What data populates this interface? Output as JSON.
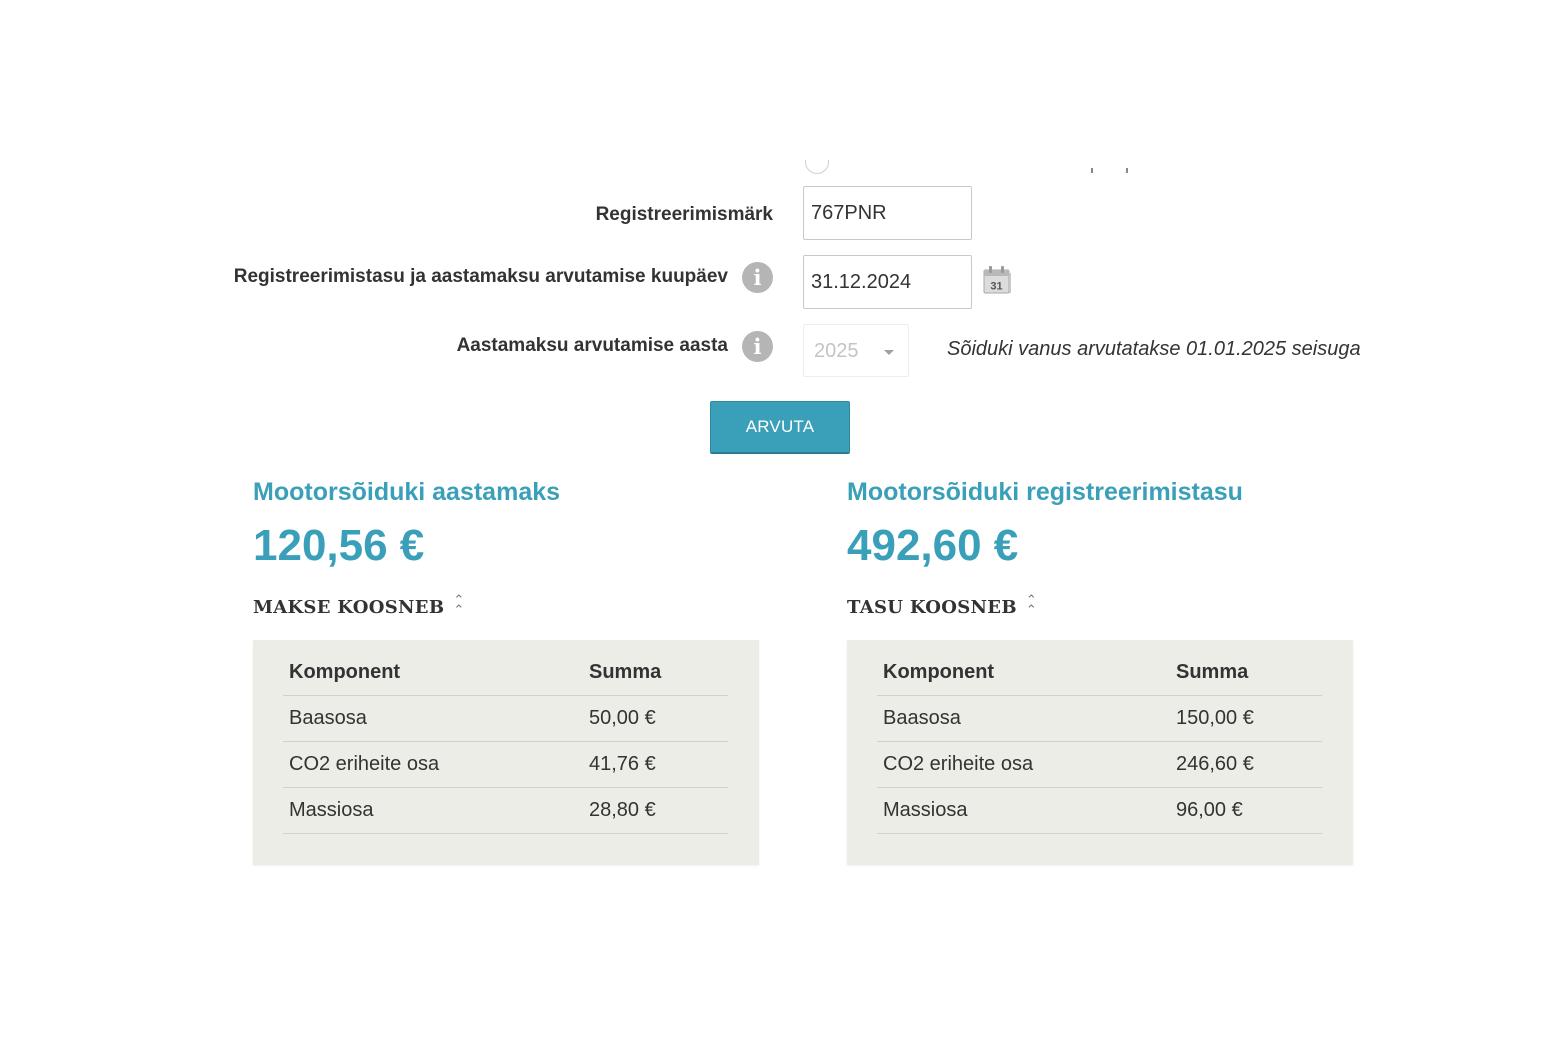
{
  "form": {
    "reg_label": "Registreerimismärk",
    "reg_value": "767PNR",
    "date_label": "Registreerimistasu ja aastamaksu arvutamise kuupäev",
    "date_value": "31.12.2024",
    "calendar_day": "31",
    "year_label": "Aastamaksu arvutamise aasta",
    "year_value": "2025",
    "age_note": "Sõiduki vanus arvutatakse 01.01.2025 seisuga",
    "info_glyph": "i",
    "calculate_label": "ARVUTA"
  },
  "icons": {
    "info": "info-icon",
    "calendar": "calendar-icon",
    "select_caret": "chevron-down-icon",
    "collapse": "chevrons-up-icon"
  },
  "colors": {
    "accent": "#3a9fb8",
    "panel_bg": "#ebede6",
    "info_icon": "#b5b5b5",
    "text": "#333333"
  },
  "annual_tax": {
    "title": "Mootorsõiduki aastamaks",
    "amount": "120,56 €",
    "toggle_label": "MAKSE KOOSNEB",
    "toggle_icon": "⌃",
    "table": {
      "headers": [
        "Komponent",
        "Summa"
      ],
      "rows": [
        [
          "Baasosa",
          "50,00 €"
        ],
        [
          "CO2 eriheite osa",
          "41,76 €"
        ],
        [
          "Massiosa",
          "28,80 €"
        ]
      ]
    }
  },
  "registration_fee": {
    "title": "Mootorsõiduki registreerimistasu",
    "amount": "492,60 €",
    "toggle_label": "TASU KOOSNEB",
    "toggle_icon": "⌃",
    "table": {
      "headers": [
        "Komponent",
        "Summa"
      ],
      "rows": [
        [
          "Baasosa",
          "150,00 €"
        ],
        [
          "CO2 eriheite osa",
          "246,60 €"
        ],
        [
          "Massiosa",
          "96,00 €"
        ]
      ]
    }
  }
}
